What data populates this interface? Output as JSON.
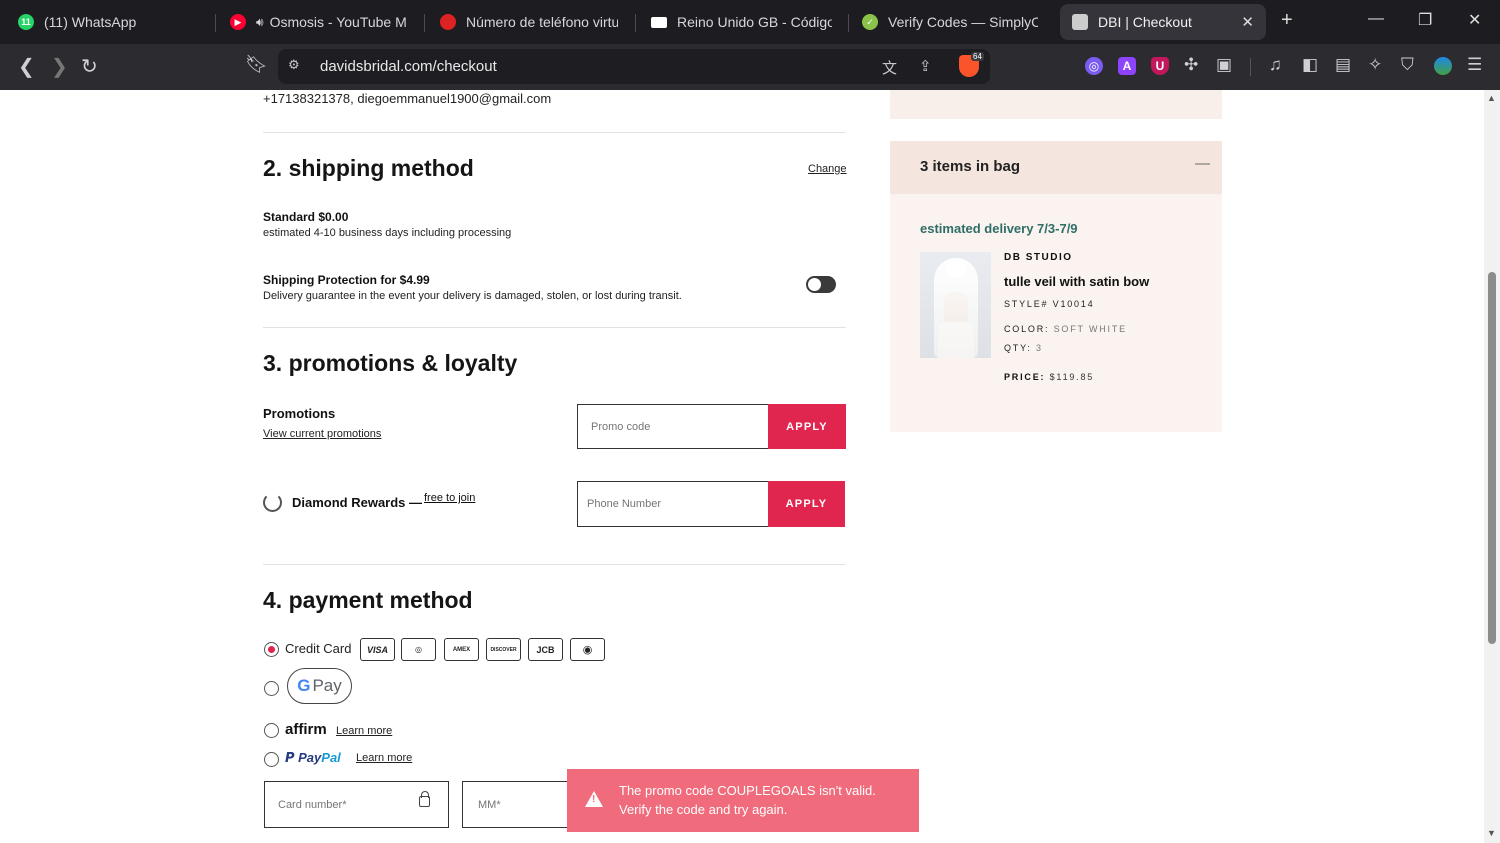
{
  "browser": {
    "tabs": [
      {
        "title": "(11) WhatsApp",
        "favicon": "whatsapp-icon",
        "color": "#25d366"
      },
      {
        "title": "Osmosis - YouTube Mu",
        "favicon": "youtube-icon",
        "color": "#ff0033"
      },
      {
        "title": "Número de teléfono virtua",
        "favicon": "phone-service-icon",
        "color": "#d22"
      },
      {
        "title": "Reino Unido GB - Código P",
        "favicon": "uk-flag-icon",
        "color": "#ffffff"
      },
      {
        "title": "Verify Codes — SimplyCod",
        "favicon": "check-badge-icon",
        "color": "#8bc34a"
      },
      {
        "title": "DBI | Checkout",
        "favicon": "page-icon",
        "color": "#cccccc"
      }
    ],
    "url": "davidsbridal.com/checkout",
    "shield_count": "64"
  },
  "checkout": {
    "contact": "+17138321378, diegoemmanuel1900@gmail.com",
    "shipping": {
      "title": "2. shipping method",
      "change": "Change",
      "standard": "Standard $0.00",
      "standard_desc": "estimated 4-10 business days including processing",
      "protection": "Shipping Protection for $4.99",
      "protection_desc": "Delivery guarantee in the event your delivery is damaged, stolen, or lost during transit.",
      "protection_enabled": false
    },
    "promotions": {
      "title": "3. promotions & loyalty",
      "label": "Promotions",
      "view_link": "View current promotions",
      "promo_placeholder": "Promo code",
      "apply": "APPLY",
      "rewards_label": "Diamond Rewards —",
      "rewards_link": "free to join",
      "phone_placeholder": "Phone Number"
    },
    "payment": {
      "title": "4. payment method",
      "credit_card": "Credit Card",
      "cards": [
        "VISA",
        "MASTERCARD",
        "AMEX",
        "DISCOVER",
        "JCB",
        "DINERS"
      ],
      "gpay": "Pay",
      "affirm": "affirm",
      "paypal_a": "Pay",
      "paypal_b": "Pal",
      "learn_more": "Learn more",
      "card_number_placeholder": "Card number*",
      "mm_placeholder": "MM*"
    }
  },
  "bag": {
    "title": "3 items in bag",
    "delivery": "estimated delivery 7/3-7/9",
    "brand": "DB STUDIO",
    "product": "tulle veil with satin bow",
    "style_label": "STYLE#",
    "style": "V10014",
    "color_label": "COLOR:",
    "color": "SOFT WHITE",
    "qty_label": "QTY:",
    "qty": "3",
    "price_label": "PRICE:",
    "price": "$119.85"
  },
  "toast": {
    "line1": "The promo code COUPLEGOALS isn't valid.",
    "line2": "Verify the code and try again."
  },
  "colors": {
    "accent": "#e0264f",
    "toast": "#f06b7b",
    "delivery": "#2f6e66",
    "bag_bg": "#faf3ef"
  }
}
